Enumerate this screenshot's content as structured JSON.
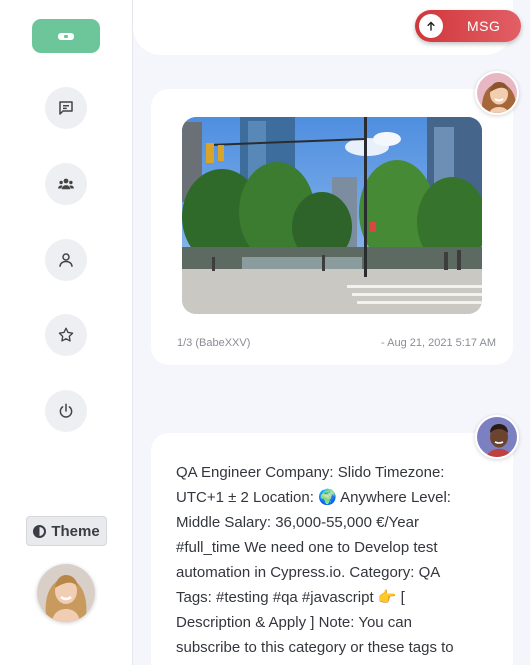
{
  "sidebar": {
    "nav": [
      {
        "name": "messages",
        "icon": "chat-bubble-icon"
      },
      {
        "name": "groups",
        "icon": "users-icon"
      },
      {
        "name": "profile",
        "icon": "user-icon"
      },
      {
        "name": "favorites",
        "icon": "star-icon"
      },
      {
        "name": "logout",
        "icon": "power-icon"
      }
    ],
    "theme_label": "Theme"
  },
  "header": {
    "msg_label": "MSG"
  },
  "posts": [
    {
      "type": "image",
      "counter": "1/3 (BabeXXV)",
      "timestamp": "- Aug 21, 2021 5:17 AM"
    },
    {
      "type": "text",
      "body": "QA Engineer Company: Slido Timezone: UTC+1 ± 2 Location: 🌍 Anywhere Level: Middle Salary: 36,000-55,000 €/Year #full_time We need one to Develop test automation in Cypress.io. Category: QA Tags: #testing #qa #javascript 👉 [ Description & Apply ] Note: You can subscribe to this category or these tags to receive custom"
    }
  ],
  "colors": {
    "accent_green": "#6cc69a",
    "msg_red": "#d0363a"
  }
}
